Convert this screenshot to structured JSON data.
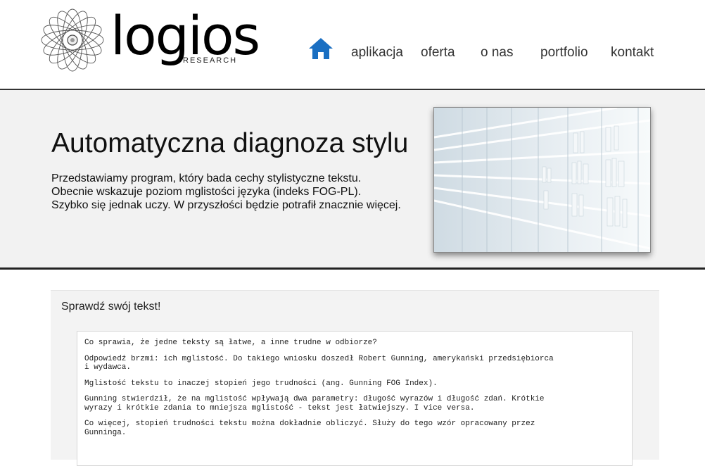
{
  "header": {
    "logo_word": "logios",
    "logo_sub": "RESEARCH",
    "nav": {
      "home_icon": "home-icon",
      "items": [
        "aplikacja",
        "oferta",
        "o nas",
        "portfolio",
        "kontakt"
      ]
    }
  },
  "hero": {
    "title": "Automatyczna diagnoza stylu",
    "lines": [
      "Przedstawiamy program, który bada cechy stylistyczne tekstu.",
      "Obecnie wskazuje poziom mglistości języka (indeks FOG-PL).",
      "Szybko się jednak uczy. W przyszłości będzie potrafił znacznie więcej."
    ],
    "image_icon": "bookshelf-image"
  },
  "panel": {
    "title": "Sprawdź swój tekst!",
    "paragraphs": [
      "Co sprawia, że jedne teksty są łatwe, a inne trudne w odbiorze?",
      "Odpowiedź brzmi: ich mglistość. Do takiego wniosku doszedł Robert Gunning, amerykański przedsiębiorca\ni wydawca.",
      "Mglistość tekstu to inaczej stopień jego trudności (ang. Gunning FOG Index).",
      "Gunning stwierdził, że na mglistość wpływają dwa parametry: długość wyrazów i długość zdań. Krótkie\nwyrazy i krótkie zdania to mniejsza mglistość - tekst jest łatwiejszy. I vice versa.",
      "Co więcej, stopień trudności tekstu można dokładnie obliczyć. Służy do tego wzór opracowany przez\nGunninga."
    ]
  },
  "colors": {
    "accent_blue": "#1a6fc2",
    "rule": "#333333",
    "hero_bg": "#f2f2f2"
  }
}
